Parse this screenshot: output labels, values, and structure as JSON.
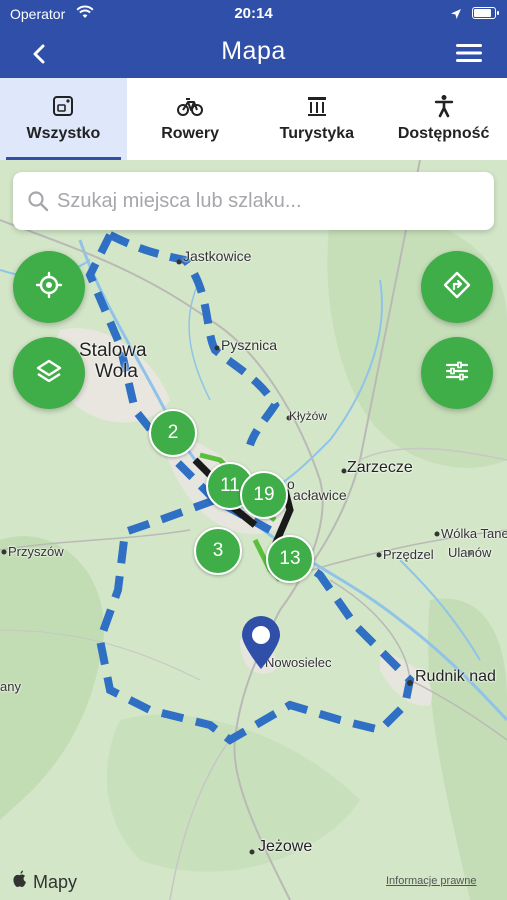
{
  "status_bar": {
    "carrier": "Operator",
    "time": "20:14"
  },
  "nav": {
    "title": "Mapa"
  },
  "tabs": [
    {
      "label": "Wszystko",
      "icon": "all-icon",
      "active": true
    },
    {
      "label": "Rowery",
      "icon": "bicycle-icon",
      "active": false
    },
    {
      "label": "Turystyka",
      "icon": "monument-icon",
      "active": false
    },
    {
      "label": "Dostępność",
      "icon": "accessibility-icon",
      "active": false
    }
  ],
  "search": {
    "placeholder": "Szukaj miejsca lub szlaku..."
  },
  "map": {
    "places": {
      "jastkowice": "Jastkowice",
      "stalowa": "Stalowa",
      "wola": "Wola",
      "pysznica": "Pysznica",
      "klyzow": "Kłyżów",
      "zarzecze": "Zarzecze",
      "aclawice": "acławice",
      "o": "o",
      "wolka": "Wólka Tane",
      "przedzel": "Przędzel",
      "ulanow": "Ulanów",
      "przyszow": "Przyszów",
      "any": "any",
      "nowosielec": "Nowosielec",
      "rudnik": "Rudnik nad",
      "jezowe": "Jeżowe"
    },
    "clusters": {
      "c2": "2",
      "c11": "11",
      "c19": "19",
      "c3": "3",
      "c13": "13"
    },
    "attribution": {
      "brand": "Mapy",
      "legal": "Informacje prawne"
    },
    "colors": {
      "route": "#2f6fc4",
      "cluster": "#3fae49",
      "header": "#2f4fa8"
    }
  }
}
